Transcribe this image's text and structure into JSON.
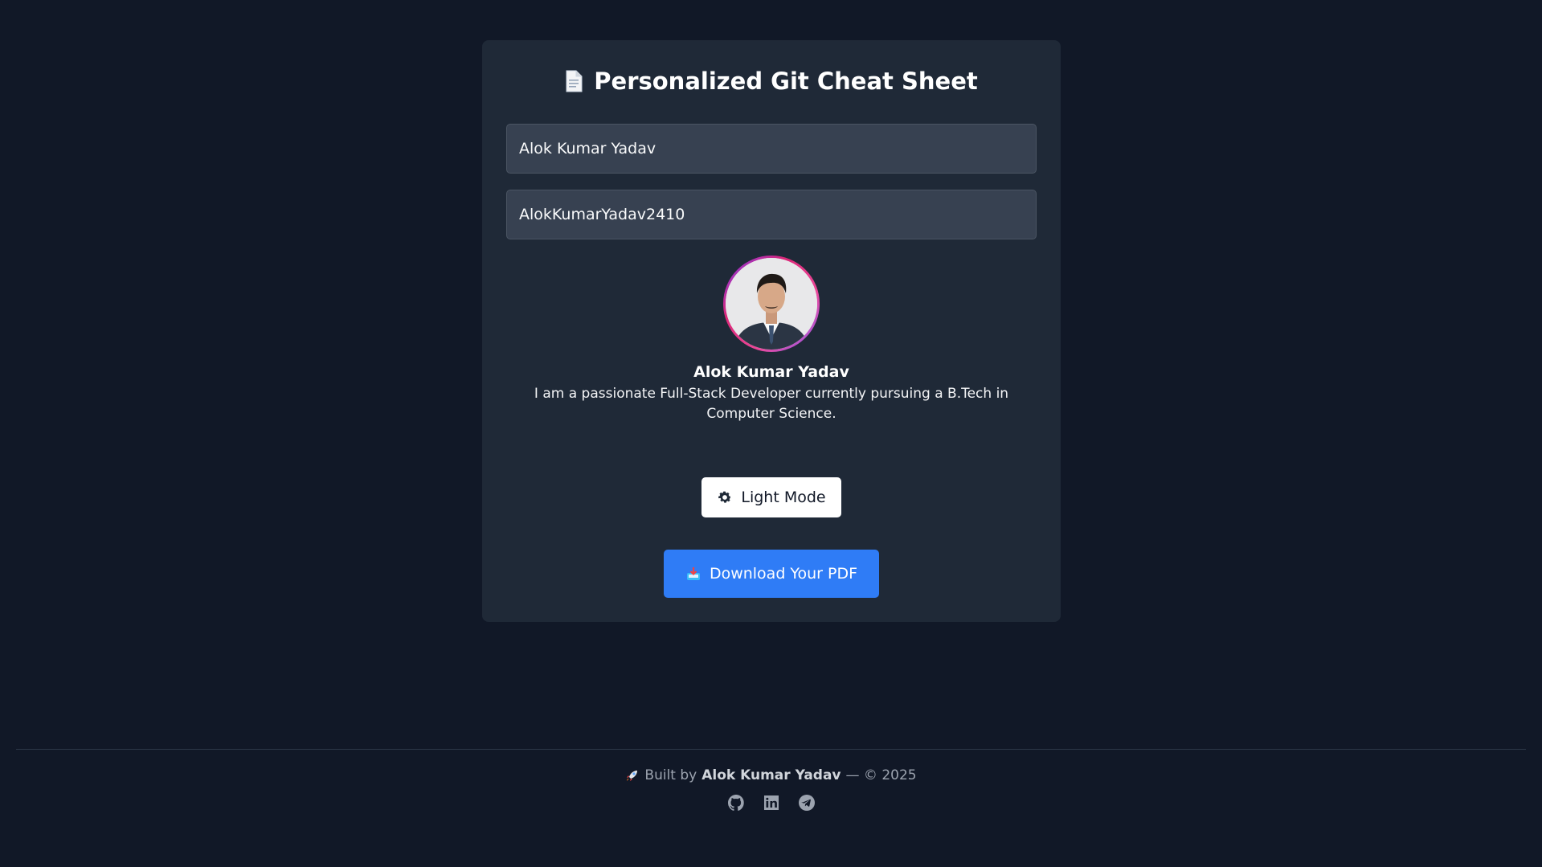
{
  "header": {
    "title": "Personalized Git Cheat Sheet",
    "icon": "document-icon"
  },
  "form": {
    "name_value": "Alok Kumar Yadav",
    "username_value": "AlokKumarYadav2410"
  },
  "profile": {
    "name": "Alok Kumar Yadav",
    "bio": "I am a passionate Full-Stack Developer currently pursuing a B.Tech in Computer Science."
  },
  "buttons": {
    "theme_label": "Light Mode",
    "theme_icon": "gear-icon",
    "download_label": "Download Your PDF",
    "download_icon": "inbox-tray-icon"
  },
  "footer": {
    "prefix": "Built by",
    "author": "Alok Kumar Yadav",
    "suffix": "— © 2025",
    "icon": "rocket-icon",
    "links": [
      "github-icon",
      "linkedin-icon",
      "telegram-icon"
    ]
  },
  "colors": {
    "background": "#111827",
    "card": "#1f2937",
    "input": "#374151",
    "accent": "#2f7cf6"
  }
}
